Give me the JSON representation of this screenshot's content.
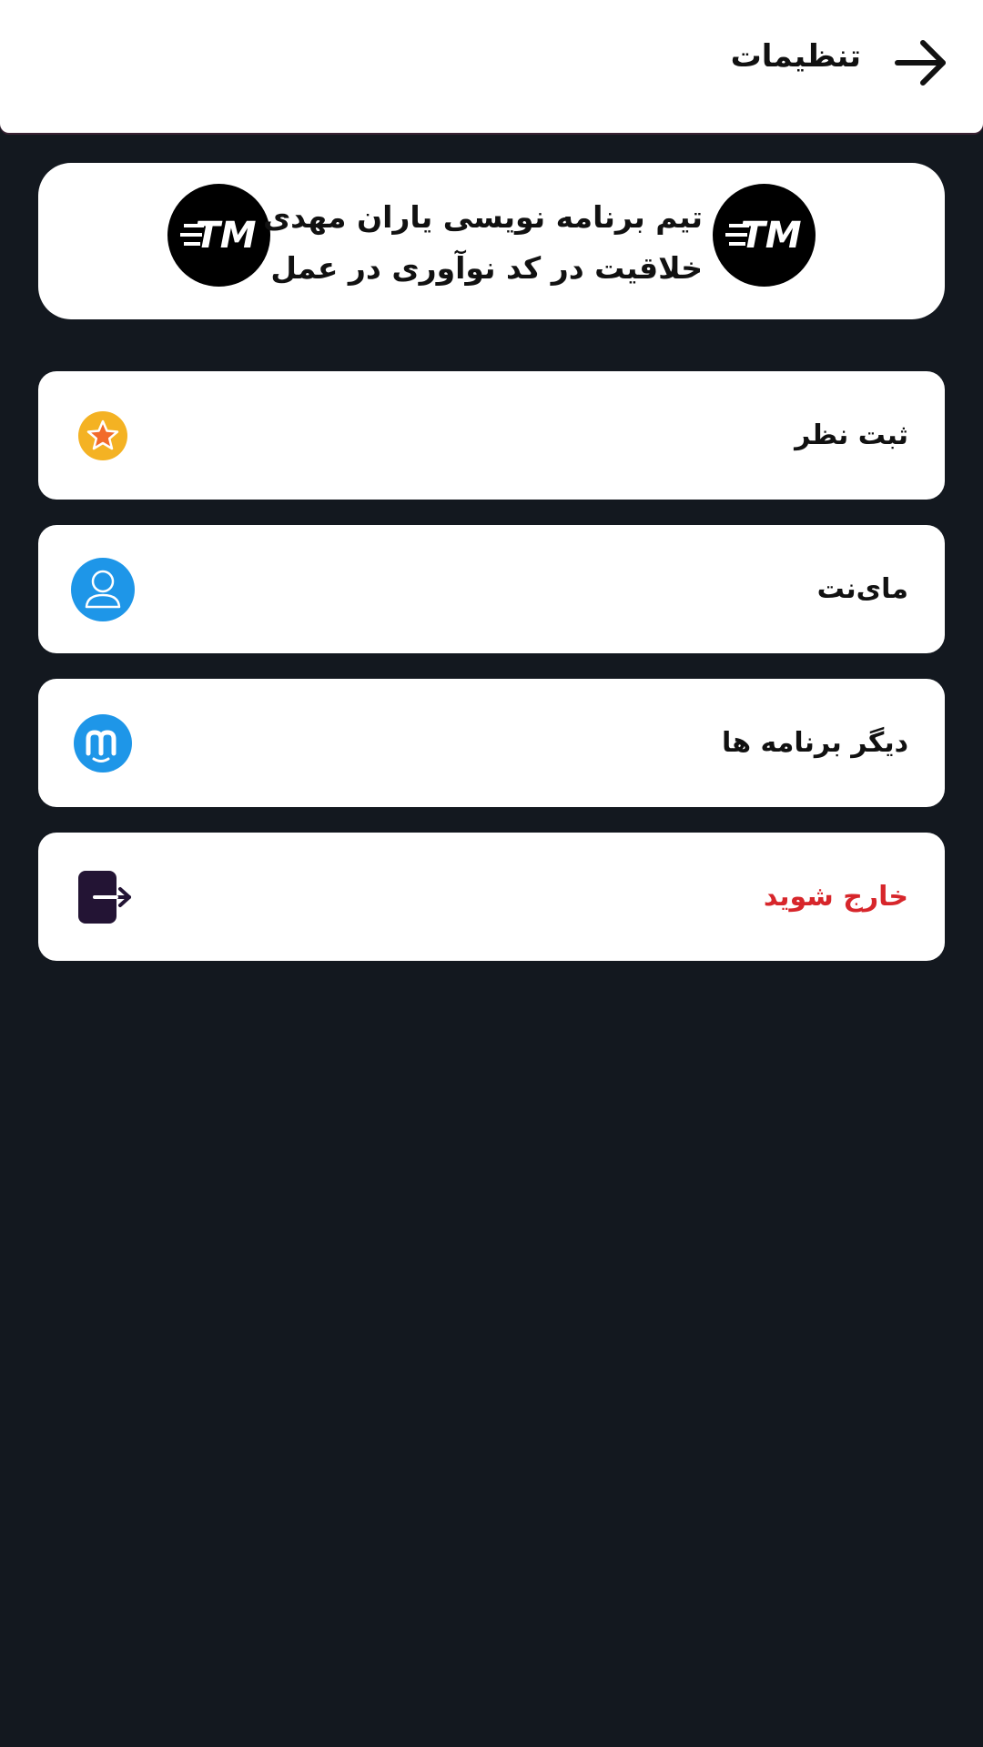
{
  "header": {
    "title": "تنظیمات",
    "back_icon": "arrow-right-icon"
  },
  "banner": {
    "line1": "تیم برنامه نویسی یاران مهدی",
    "line2": "خلاقیت در کد نوآوری در عمل",
    "logo_text": "TM",
    "logo_icon": "team-logo-icon"
  },
  "menu": {
    "items": [
      {
        "label": "ثبت نظر",
        "icon": "star-icon",
        "color": "#f4b223"
      },
      {
        "label": "مای‌نت",
        "icon": "user-icon",
        "color": "#1e96e8"
      },
      {
        "label": "دیگر برنامه ها",
        "icon": "myket-icon",
        "color": "#1e96e8"
      },
      {
        "label": "خارج شوید",
        "icon": "logout-icon",
        "color": "#d7262b"
      }
    ]
  },
  "colors": {
    "background": "#13181f",
    "card": "#ffffff",
    "danger": "#d7262b",
    "logout_icon": "#231434"
  }
}
